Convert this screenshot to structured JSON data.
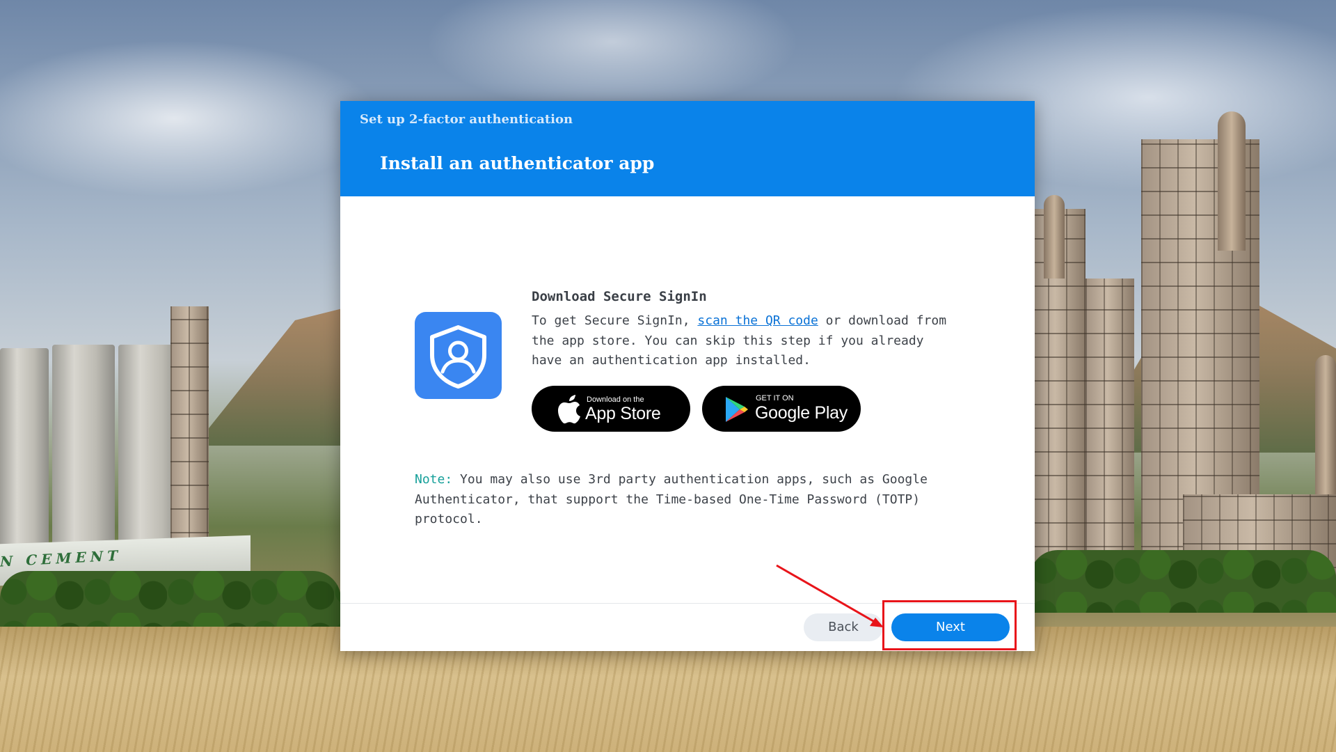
{
  "dialog": {
    "kicker": "Set up 2-factor authentication",
    "title": "Install an authenticator app"
  },
  "content": {
    "heading": "Download Secure SignIn",
    "body_before_link": "To get Secure SignIn, ",
    "link_text": "scan the QR code",
    "body_after_link": " or download from the app store. You can skip this step if you already have an authentication app installed."
  },
  "stores": {
    "appstore": {
      "small": "Download on the",
      "big": "App Store",
      "icon": "apple-icon"
    },
    "googleplay": {
      "small": "GET IT ON",
      "big": "Google Play",
      "icon": "google-play-icon"
    }
  },
  "note": {
    "label": "Note:",
    "text": " You may also use 3rd party authentication apps, such as Google Authenticator, that support the Time-based One-Time Password (TOTP) protocol."
  },
  "footer": {
    "back_label": "Back",
    "next_label": "Next"
  },
  "colors": {
    "header": "#0a83ea",
    "primary_button": "#0a83ea",
    "app_icon": "#3a86f1",
    "note_label": "#17a09a",
    "annotation": "#e8141a"
  },
  "background": {
    "sign_text": "N CEMENT"
  }
}
